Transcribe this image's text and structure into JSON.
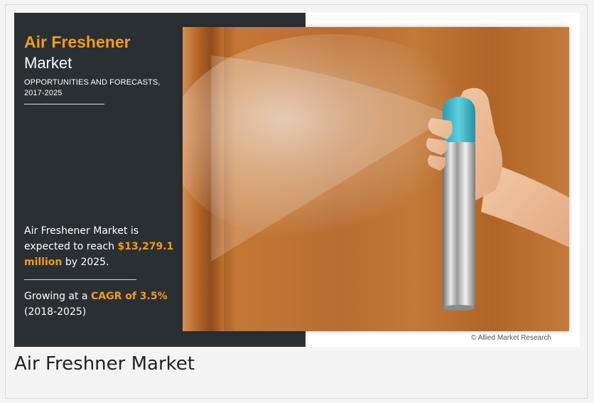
{
  "infographic": {
    "title_accent": "Air Freshener",
    "title_main": "Market",
    "subtitle": "OPPORTUNITIES AND FORECASTS, 2017-2025",
    "stat1_prefix": "Air Freshener Market is expected to reach ",
    "stat1_value": "$13,279.1 million",
    "stat1_suffix": " by 2025.",
    "stat2_prefix": "Growing at a ",
    "stat2_value": "CAGR of 3.5%",
    "stat2_suffix": "(2018-2025)",
    "credit": "© Allied Market Research"
  },
  "caption": "Air Freshner Market",
  "colors": {
    "panel": "#2a2f34",
    "accent": "#f39a1c",
    "wood": "#b96d31",
    "cap": "#3fb8c8"
  }
}
